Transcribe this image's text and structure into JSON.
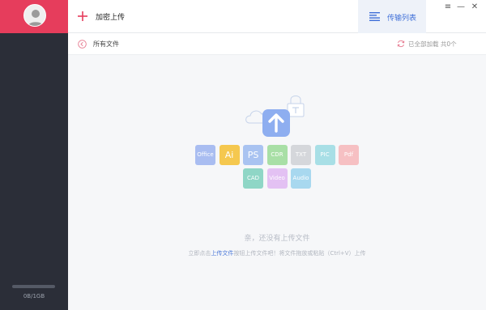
{
  "sidebar": {
    "storage": {
      "used_fraction": 0.0,
      "text": "0B/1GB"
    }
  },
  "topbar": {
    "upload_label": "加密上传",
    "transfer_tab_label": "传输列表",
    "window": {
      "menu": "≡",
      "minimize": "—",
      "close": "✕"
    }
  },
  "breadcrumb": {
    "label": "所有文件",
    "status": "已全部加载 共0个"
  },
  "empty_state": {
    "title": "亲，还没有上传文件",
    "hint_prefix": "立即点击",
    "hint_link": "上传文件",
    "hint_suffix": "按钮上传文件吧！将文件拖放或粘贴（Ctrl+V）上传"
  },
  "file_types": [
    {
      "label": "Office",
      "color": "#a9bdf1"
    },
    {
      "label": "Ai",
      "color": "#f5c84f"
    },
    {
      "label": "PS",
      "color": "#a9c3f1"
    },
    {
      "label": "CDR",
      "color": "#a8dfa6"
    },
    {
      "label": "TXT",
      "color": "#d5d7db"
    },
    {
      "label": "PIC",
      "color": "#a8dfe6"
    },
    {
      "label": "Pdf",
      "color": "#f6c0c3"
    },
    {
      "label": "CAD",
      "color": "#8fd6c6"
    },
    {
      "label": "Video",
      "color": "#e3c1f3"
    },
    {
      "label": "Audio",
      "color": "#a8d8ef"
    }
  ],
  "colors": {
    "accent_red": "#e63d5c",
    "accent_blue": "#3f6fd8",
    "sidebar_bg": "#2b2e38"
  }
}
